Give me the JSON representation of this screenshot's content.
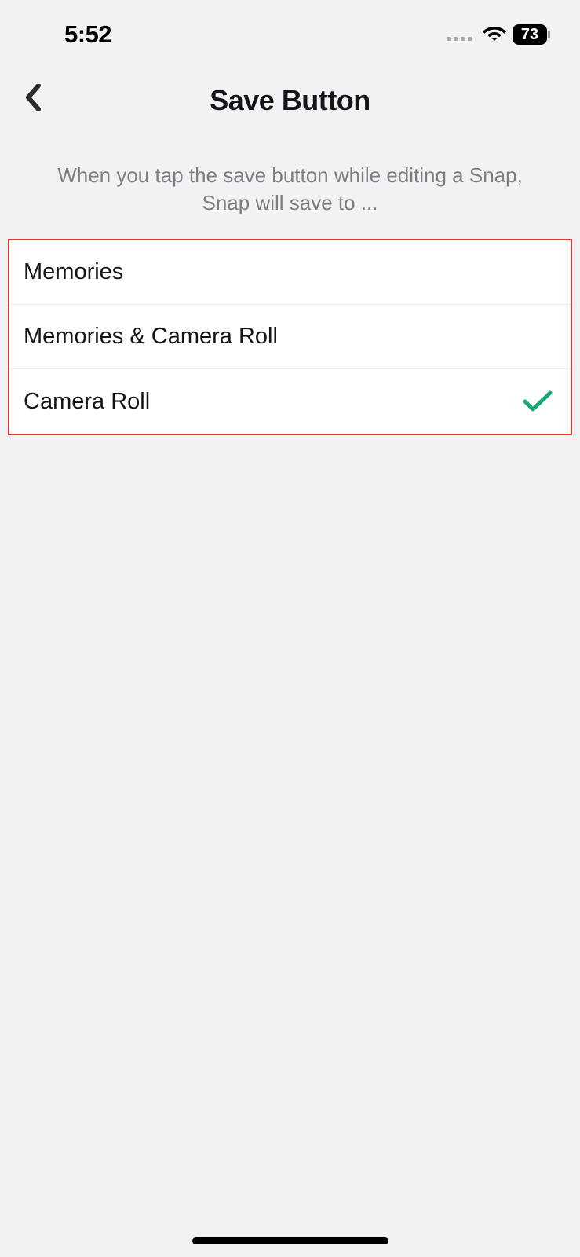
{
  "statusBar": {
    "time": "5:52",
    "battery": "73"
  },
  "header": {
    "title": "Save Button"
  },
  "description": "When you tap the save button while editing a Snap, Snap will save to ...",
  "options": [
    {
      "label": "Memories",
      "selected": false
    },
    {
      "label": "Memories & Camera Roll",
      "selected": false
    },
    {
      "label": "Camera Roll",
      "selected": true
    }
  ]
}
